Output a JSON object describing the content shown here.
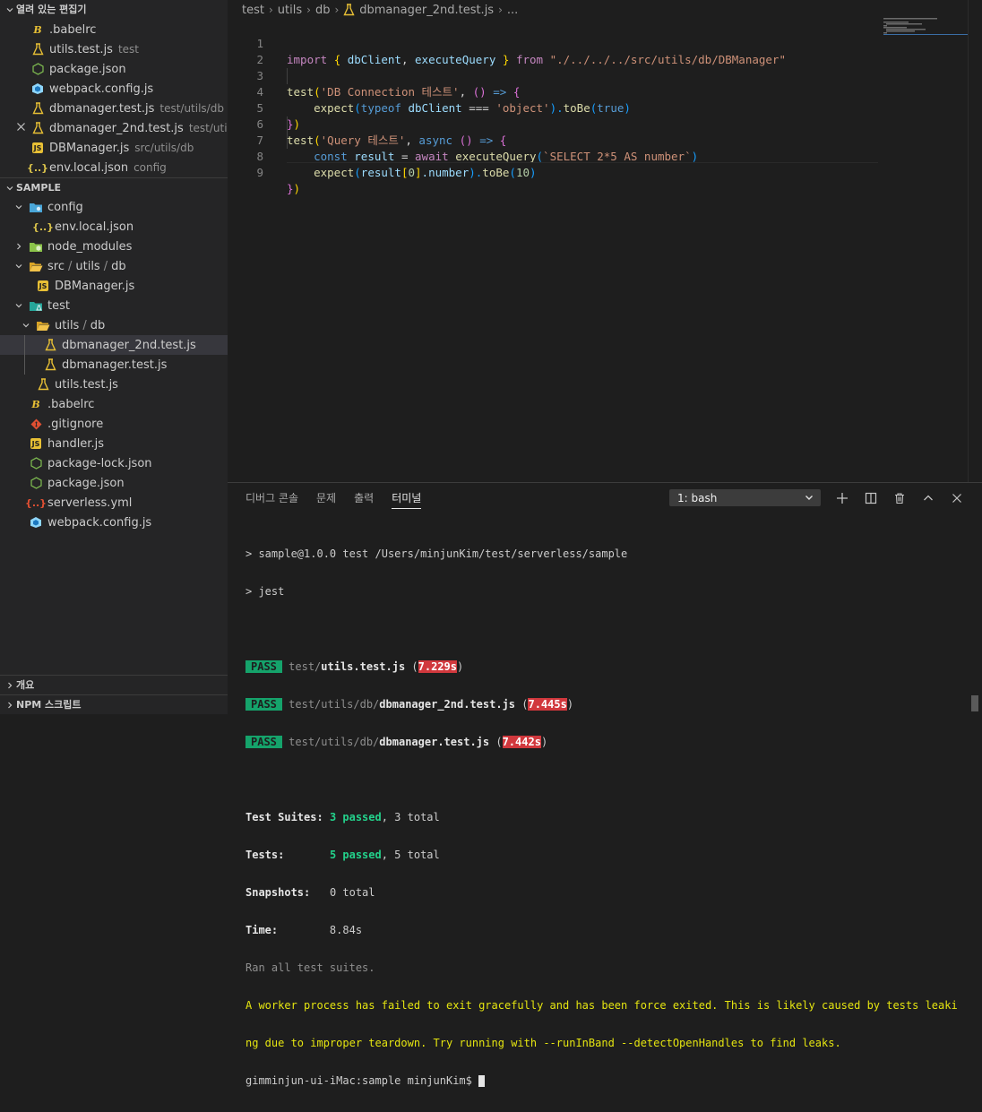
{
  "sidebar": {
    "open_editors": {
      "title": "열려 있는 편집기",
      "items": [
        {
          "name": ".babelrc",
          "desc": "",
          "icon": "babel-icon"
        },
        {
          "name": "utils.test.js",
          "desc": "test",
          "icon": "flask-icon"
        },
        {
          "name": "package.json",
          "desc": "",
          "icon": "nodejs-icon"
        },
        {
          "name": "webpack.config.js",
          "desc": "",
          "icon": "webpack-icon"
        },
        {
          "name": "dbmanager.test.js",
          "desc": "test/utils/db",
          "icon": "flask-icon"
        },
        {
          "name": "dbmanager_2nd.test.js",
          "desc": "test/utils/db",
          "icon": "flask-icon"
        },
        {
          "name": "DBManager.js",
          "desc": "src/utils/db",
          "icon": "js-icon"
        },
        {
          "name": "env.local.json",
          "desc": "config",
          "icon": "json-icon"
        }
      ]
    },
    "explorer": {
      "title": "SAMPLE",
      "items": [
        {
          "name": "config"
        },
        {
          "name": "env.local.json"
        },
        {
          "name": "node_modules"
        },
        {
          "name_parts": [
            "src",
            "utils",
            "db"
          ]
        },
        {
          "name": "DBManager.js"
        },
        {
          "name": "test"
        },
        {
          "name_parts": [
            "utils",
            "db"
          ]
        },
        {
          "name": "dbmanager_2nd.test.js"
        },
        {
          "name": "dbmanager.test.js"
        },
        {
          "name": "utils.test.js"
        },
        {
          "name": ".babelrc"
        },
        {
          "name": ".gitignore"
        },
        {
          "name": "handler.js"
        },
        {
          "name": "package-lock.json"
        },
        {
          "name": "package.json"
        },
        {
          "name": "serverless.yml"
        },
        {
          "name": "webpack.config.js"
        }
      ]
    },
    "outline_title": "개요",
    "npm_title": "NPM 스크립트"
  },
  "breadcrumb": [
    "test",
    "utils",
    "db",
    "dbmanager_2nd.test.js",
    "..."
  ],
  "code": {
    "line_numbers": [
      "1",
      "2",
      "3",
      "4",
      "5",
      "6",
      "7",
      "8",
      "9"
    ],
    "line1": {
      "kw_import": "import",
      "b_open": "{",
      "id1": "dbClient",
      "comma": ",",
      "id2": "executeQuery",
      "b_close": "}",
      "kw_from": "from",
      "path": "\"./../../../src/utils/db/DBManager\""
    },
    "line3": {
      "fn": "test",
      "p_open": "(",
      "str": "'DB Connection 테스트'",
      "comma": ",",
      "args": "()",
      "arrow": "=>",
      "b_open": "{"
    },
    "line4": {
      "fn": "expect",
      "p_open": "(",
      "kw": "typeof",
      "id": "dbClient",
      "op": "===",
      "str": "'object'",
      "p_close": ").",
      "fn2": "toBe",
      "p2_open": "(",
      "val": "true",
      "p2_close": ")"
    },
    "line5": {
      "b_close": "}",
      "p_close": ")"
    },
    "line6": {
      "fn": "test",
      "p_open": "(",
      "str": "'Query 테스트'",
      "comma": ",",
      "kw": "async",
      "args": "()",
      "arrow": "=>",
      "b_open": "{"
    },
    "line7": {
      "kw": "const",
      "id": "result",
      "op": "=",
      "kw2": "await",
      "fn": "executeQuery",
      "p_open": "(",
      "str": "`SELECT 2*5 AS number`",
      "p_close": ")"
    },
    "line8": {
      "fn": "expect",
      "p_open": "(",
      "id": "result",
      "br_open": "[",
      "num": "0",
      "br_close": "]",
      "dot_prop": ".number",
      "p_close": ").",
      "fn2": "toBe",
      "p2_open": "(",
      "val": "10",
      "p2_close": ")"
    },
    "line9": {
      "b_close": "}",
      "p_close": ")"
    }
  },
  "panel": {
    "tabs": [
      "디버그 콘솔",
      "문제",
      "출력",
      "터미널"
    ],
    "active_tab": "터미널",
    "terminal_select": "1: bash"
  },
  "terminal": {
    "cmd1": "> sample@1.0.0 test /Users/minjunKim/test/serverless/sample",
    "cmd2": "> jest",
    "pass_label": "PASS",
    "results": [
      {
        "dir": "test/",
        "file": "utils.test.js",
        "time": "7.229s"
      },
      {
        "dir": "test/utils/db/",
        "file": "dbmanager_2nd.test.js",
        "time": "7.445s"
      },
      {
        "dir": "test/utils/db/",
        "file": "dbmanager.test.js",
        "time": "7.442s"
      }
    ],
    "suites_label": "Test Suites:",
    "suites_passed": "3 passed",
    "suites_total": ", 3 total",
    "tests_label": "Tests:",
    "tests_passed": "5 passed",
    "tests_total": ", 5 total",
    "snapshots_label": "Snapshots:",
    "snapshots_value": "0 total",
    "time_label": "Time:",
    "time_value": "8.84s",
    "ran_all": "Ran all test suites.",
    "warning1": "A worker process has failed to exit gracefully and has been force exited. This is likely caused by tests leaki",
    "warning2": "ng due to improper teardown. Try running with --runInBand --detectOpenHandles to find leaks.",
    "prompt": "gimminjun-ui-iMac:sample minjunKim$ "
  }
}
